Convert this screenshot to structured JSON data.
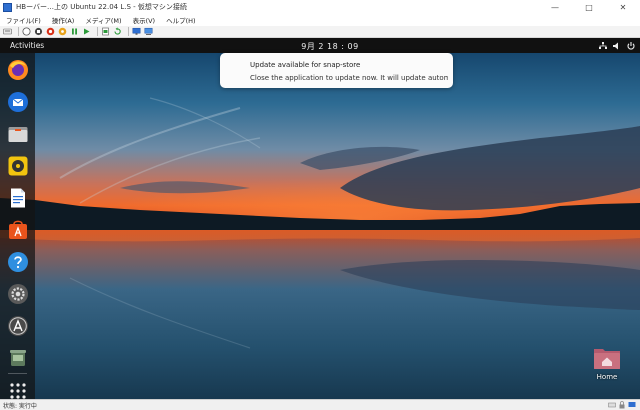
{
  "host": {
    "title": "HBーバー…上の Ubuntu 22.04 L.S - 仮想マシン接続",
    "window_controls": {
      "minimize": "—",
      "maximize": "□",
      "close": "✕"
    },
    "menu": [
      "ファイル(F)",
      "操作(A)",
      "メディア(M)",
      "表示(V)",
      "ヘルプ(H)"
    ],
    "statusbar": {
      "text": "状態: 実行中"
    }
  },
  "colors": {
    "accent_red": "#d8321a",
    "accent_green": "#2c9a3a",
    "accent_blue": "#2f6fd0",
    "ubuntu_orange": "#e9541c",
    "top_bar": "#111111",
    "dock": "#141414"
  },
  "guest": {
    "topbar": {
      "activities": "Activities",
      "clock": "9月 2  18 : 09",
      "tray_icons": [
        "network-icon",
        "volume-icon",
        "power-icon"
      ]
    },
    "dock": {
      "items": [
        {
          "name": "firefox-icon"
        },
        {
          "name": "thunderbird-icon"
        },
        {
          "name": "files-icon"
        },
        {
          "name": "rhythmbox-icon"
        },
        {
          "name": "libreoffice-writer-icon"
        },
        {
          "name": "ubuntu-software-icon"
        },
        {
          "name": "help-icon"
        },
        {
          "name": "settings-icon"
        },
        {
          "name": "software-updater-icon"
        },
        {
          "name": "trash-icon"
        },
        {
          "name": "show-apps-icon"
        }
      ]
    },
    "notification": {
      "title": "Update available for snap-store",
      "body": "Close the application to update now. It will update automatic…"
    },
    "desktop": {
      "home_label": "Home"
    }
  }
}
